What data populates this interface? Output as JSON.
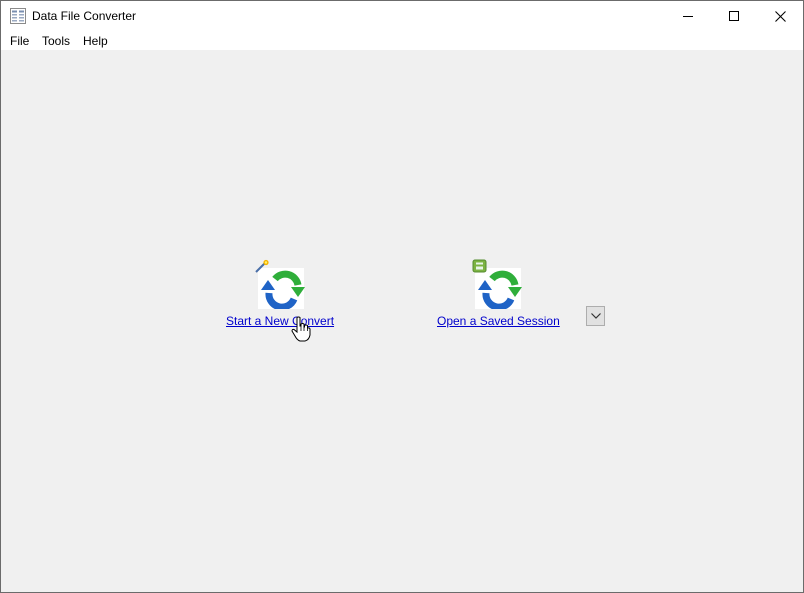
{
  "window": {
    "title": "Data File Converter",
    "controls": [
      "minimize-icon",
      "maximize-icon",
      "close-icon"
    ]
  },
  "menu": {
    "items": [
      {
        "label": "File"
      },
      {
        "label": "Tools"
      },
      {
        "label": "Help"
      }
    ]
  },
  "actions": {
    "new_convert": {
      "label": "Start a New Convert",
      "icon": "convert-wizard-icon"
    },
    "open_session": {
      "label": "Open a Saved Session",
      "icon": "saved-session-icon"
    },
    "dropdown_icon": "chevron-down-icon"
  },
  "colors": {
    "link": "#0000cc",
    "background": "#f0f0f0",
    "arrow_green": "#2fae3a",
    "arrow_blue": "#1f63c6"
  }
}
